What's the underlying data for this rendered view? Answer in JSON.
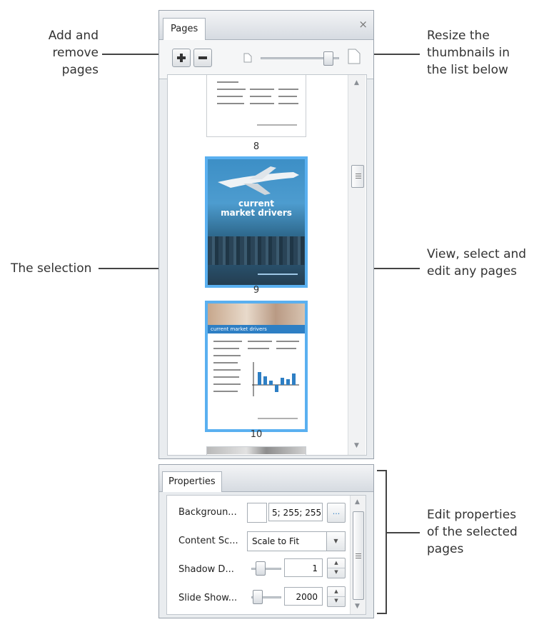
{
  "callouts": {
    "add_remove": [
      "Add and",
      "remove",
      "pages"
    ],
    "resize": [
      "Resize the",
      "thumbnails in",
      "the list below"
    ],
    "selection": "The selection",
    "view_select": [
      "View, select and",
      "edit any pages"
    ],
    "edit_props": [
      "Edit properties",
      "of the selected",
      "pages"
    ]
  },
  "pages_panel": {
    "tab_label": "Pages",
    "close_glyph": "×",
    "thumbnails": [
      {
        "number": "8"
      },
      {
        "number": "9",
        "title": "current\nmarket drivers"
      },
      {
        "number": "10",
        "title": "current market drivers"
      }
    ]
  },
  "properties_panel": {
    "tab_label": "Properties",
    "rows": [
      {
        "label": "Backgroun...",
        "value": "5; 255; 255",
        "button": "..."
      },
      {
        "label": "Content Sc...",
        "value": "Scale to Fit"
      },
      {
        "label": "Shadow D...",
        "value": "1"
      },
      {
        "label": "Slide Show...",
        "value": "2000"
      }
    ]
  },
  "colors": {
    "selection_border": "#5ab0f0",
    "accent_blue": "#2e7fc4"
  }
}
